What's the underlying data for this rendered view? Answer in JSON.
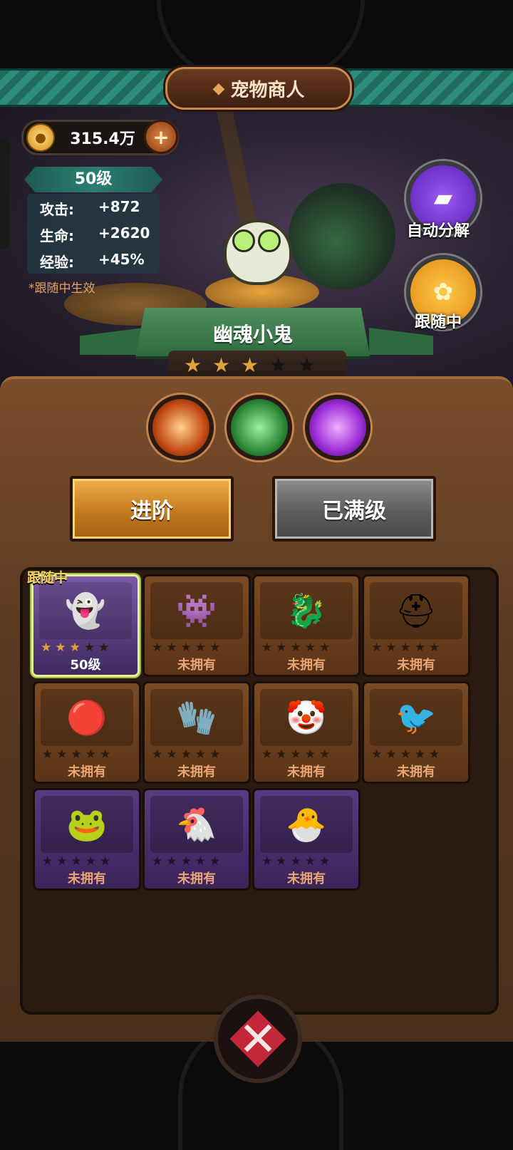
{
  "header": {
    "title": "宠物商人"
  },
  "currency": {
    "amount": "315.4万",
    "plus_symbol": "+"
  },
  "stats": {
    "level": "50级",
    "rows": [
      {
        "label": "攻击:",
        "value": "+872"
      },
      {
        "label": "生命:",
        "value": "+2620"
      },
      {
        "label": "经验:",
        "value": "+45%"
      }
    ],
    "note": "*跟随中生效"
  },
  "side_buttons": {
    "auto_decompose": "自动分解",
    "following": "跟随中"
  },
  "pet": {
    "name": "幽魂小鬼",
    "stars_filled": 3,
    "stars_total": 5
  },
  "actions": {
    "advance": "进阶",
    "maxed": "已满级"
  },
  "grid": {
    "follow_tag": "跟随中",
    "cards": [
      {
        "icon": "ghost-pet-icon",
        "status": "50级",
        "stars": 3,
        "rarity": "green",
        "active": true
      },
      {
        "icon": "chest-monster-icon",
        "status": "未拥有",
        "stars": 0,
        "rarity": "orange"
      },
      {
        "icon": "dragon-icon",
        "status": "未拥有",
        "stars": 0,
        "rarity": "orange"
      },
      {
        "icon": "knight-icon",
        "status": "未拥有",
        "stars": 0,
        "rarity": "orange"
      },
      {
        "icon": "daruma-icon",
        "status": "未拥有",
        "stars": 0,
        "rarity": "orange"
      },
      {
        "icon": "gauntlet-icon",
        "status": "未拥有",
        "stars": 0,
        "rarity": "orange"
      },
      {
        "icon": "clown-icon",
        "status": "未拥有",
        "stars": 0,
        "rarity": "orange"
      },
      {
        "icon": "crow-icon",
        "status": "未拥有",
        "stars": 0,
        "rarity": "orange"
      },
      {
        "icon": "frog-icon",
        "status": "未拥有",
        "stars": 0,
        "rarity": "purple"
      },
      {
        "icon": "chicken-icon",
        "status": "未拥有",
        "stars": 0,
        "rarity": "purple"
      },
      {
        "icon": "egg-bird-icon",
        "status": "未拥有",
        "stars": 0,
        "rarity": "purple"
      }
    ]
  },
  "colors": {
    "accent_gold": "#f1b04a",
    "teal": "#2d8c7a",
    "panel_brown": "#5a3a22",
    "purple": "#5a3a80"
  }
}
